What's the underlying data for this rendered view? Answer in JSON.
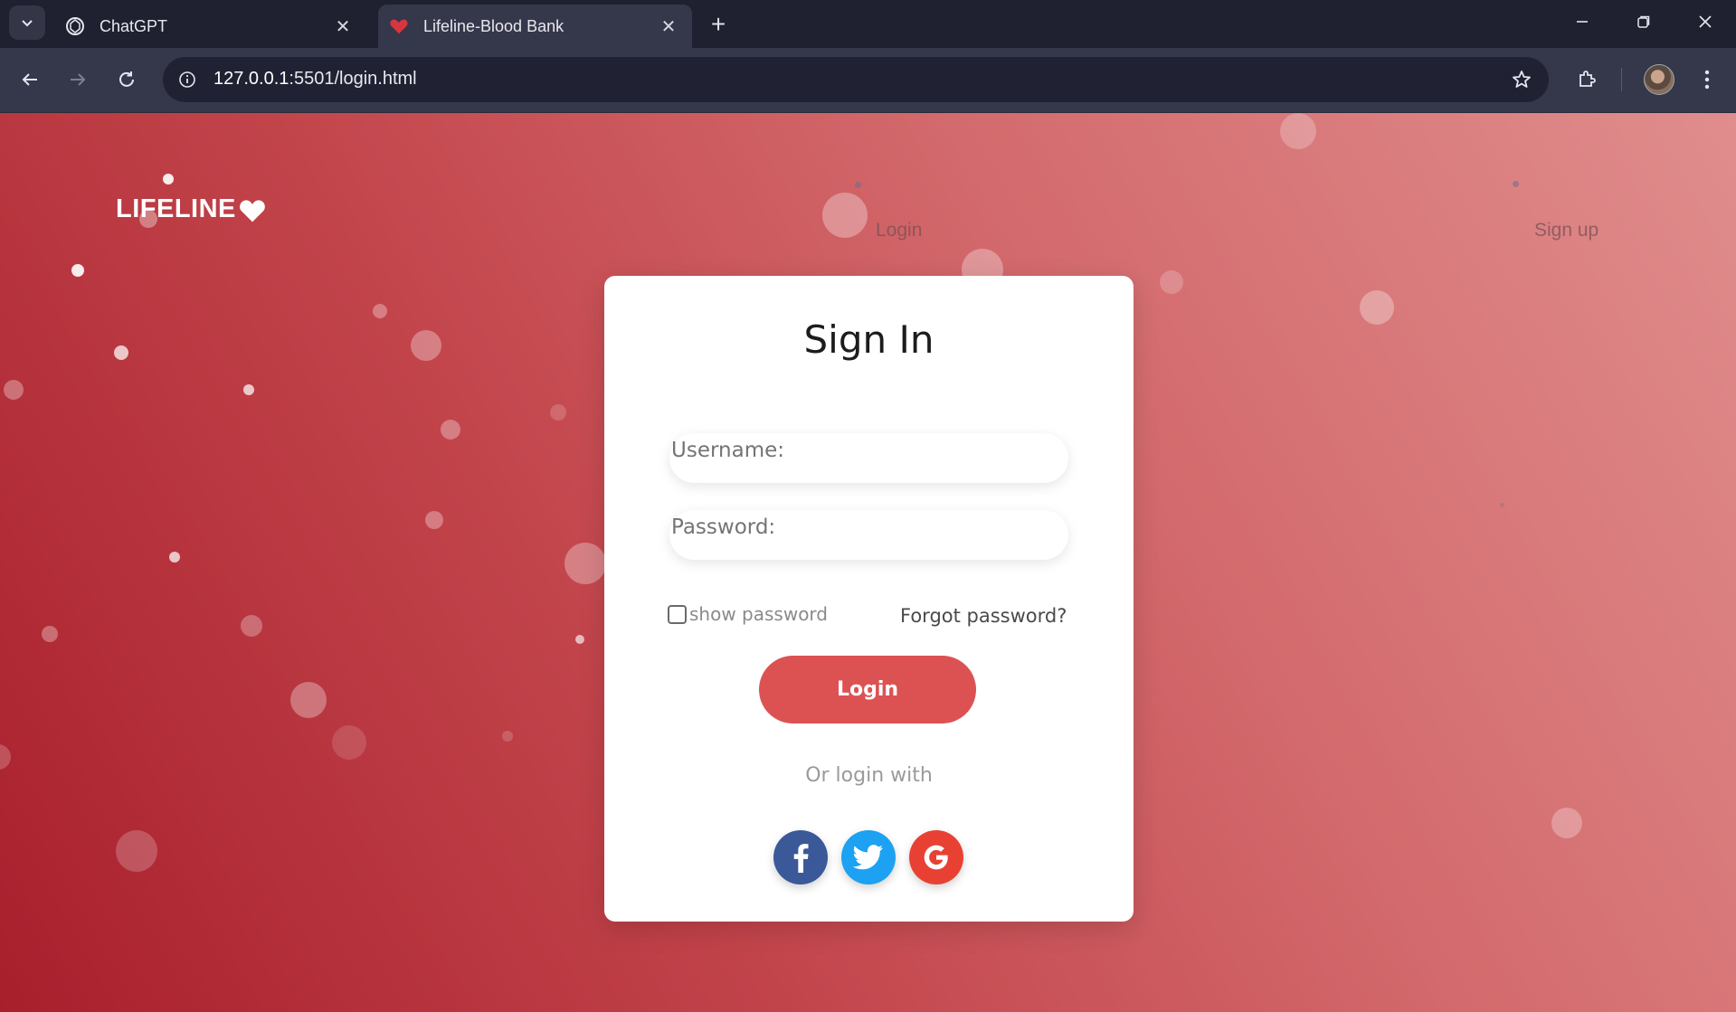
{
  "browser": {
    "tabs": [
      {
        "title": "ChatGPT",
        "icon": "chatgpt-icon",
        "active": false
      },
      {
        "title": "Lifeline-Blood Bank",
        "icon": "heart-icon",
        "active": true
      }
    ],
    "url_host": "127.0.0.1",
    "url_path": ":5501/login.html"
  },
  "page": {
    "logo_text": "LIFELINE",
    "nav": {
      "login": "Login",
      "signup": "Sign up"
    },
    "card": {
      "title": "Sign In",
      "username_placeholder": "Username:",
      "password_placeholder": "Password:",
      "show_password_label": "show password",
      "show_password_checked": false,
      "forgot_password": "Forgot password?",
      "login_button": "Login",
      "or_login_with": "Or login with",
      "social": [
        "facebook-icon",
        "twitter-icon",
        "google-icon"
      ]
    },
    "colors": {
      "accent": "#dc5253",
      "facebook": "#3b5998",
      "twitter": "#1da1f2",
      "google": "#e84133"
    }
  }
}
